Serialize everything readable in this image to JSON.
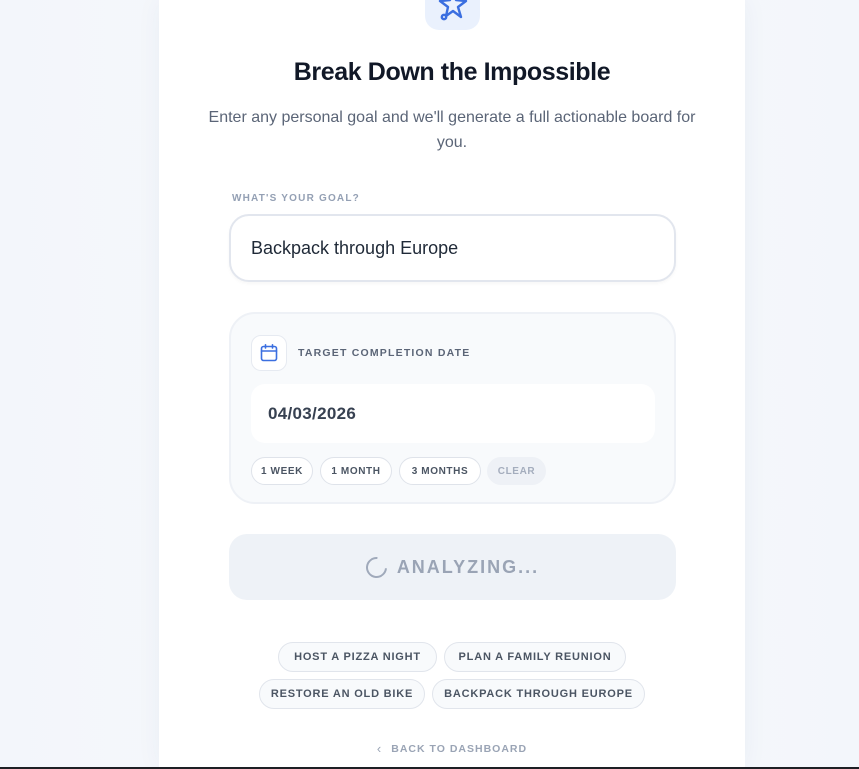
{
  "hero": {
    "icon": "sparkle-plane-icon",
    "title": "Break Down the Impossible",
    "subtitle": "Enter any personal goal and we'll generate a full actionable board for you."
  },
  "goal": {
    "label": "WHAT'S YOUR GOAL?",
    "value": "Backpack through Europe"
  },
  "target_date": {
    "icon": "calendar-icon",
    "label": "TARGET COMPLETION DATE",
    "value": "04/03/2026",
    "presets": [
      "1 WEEK",
      "1 MONTH",
      "3 MONTHS"
    ],
    "clear_label": "CLEAR"
  },
  "submit": {
    "label": "ANALYZING...",
    "state": "loading"
  },
  "suggestions": [
    "HOST A PIZZA NIGHT",
    "PLAN A FAMILY REUNION",
    "RESTORE AN OLD BIKE",
    "BACKPACK THROUGH EUROPE"
  ],
  "footer": {
    "back_label": "BACK TO DASHBOARD",
    "back_icon": "chevron-left-icon"
  },
  "colors": {
    "accent": "#3b6fe0",
    "title": "#111827",
    "muted": "#9aa4b5"
  }
}
